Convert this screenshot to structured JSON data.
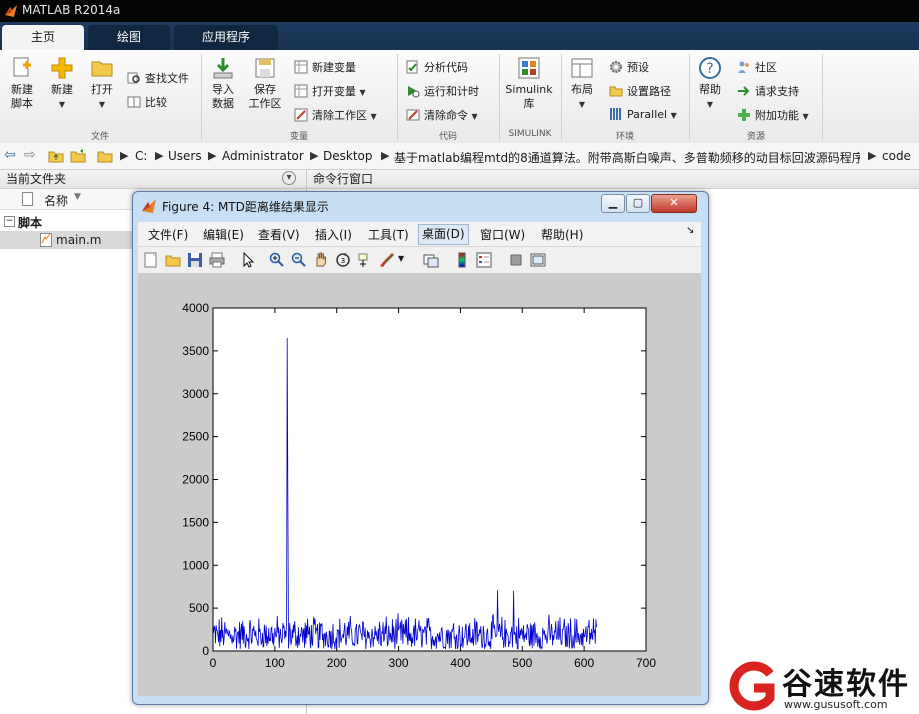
{
  "window": {
    "title": "MATLAB R2014a"
  },
  "tabs": [
    {
      "label": "主页",
      "active": true
    },
    {
      "label": "绘图",
      "active": false
    },
    {
      "label": "应用程序",
      "active": false
    }
  ],
  "ribbon": {
    "file": {
      "new_script": [
        "新建",
        "脚本"
      ],
      "new": "新建",
      "open": "打开",
      "find_files": "查找文件",
      "compare": "比较",
      "group_label": "文件"
    },
    "variable": {
      "import": [
        "导入",
        "数据"
      ],
      "save_ws": [
        "保存",
        "工作区"
      ],
      "new_var": "新建变量",
      "open_var": "打开变量",
      "clear_ws": "清除工作区",
      "group_label": "变量"
    },
    "code": {
      "analyze": "分析代码",
      "run_time": "运行和计时",
      "clear_cmd": "清除命令",
      "group_label": "代码"
    },
    "simulink": {
      "btn": [
        "Simulink",
        "库"
      ],
      "group_label": "SIMULINK"
    },
    "env": {
      "layout": "布局",
      "prefs": "预设",
      "set_path": "设置路径",
      "parallel": "Parallel",
      "group_label": "环境"
    },
    "resources": {
      "help": "帮助",
      "community": "社区",
      "request_support": "请求支持",
      "addons": "附加功能",
      "group_label": "资源"
    }
  },
  "address": {
    "crumbs": [
      "C:",
      "Users",
      "Administrator",
      "Desktop",
      "基于matlab编程mtd的8通道算法。附带高斯白噪声、多普勒频移的动目标回波源码程序",
      "code"
    ]
  },
  "current_folder": {
    "title": "当前文件夹",
    "col_name": "名称",
    "group": "脚本",
    "files": [
      "main.m"
    ]
  },
  "command_window": {
    "title": "命令行窗口"
  },
  "figure": {
    "title": "Figure 4: MTD距离维结果显示",
    "menus": [
      "文件(F)",
      "编辑(E)",
      "查看(V)",
      "插入(I)",
      "工具(T)",
      "桌面(D)",
      "窗口(W)",
      "帮助(H)"
    ],
    "selected_menu": "桌面(D)"
  },
  "chart_data": {
    "type": "line",
    "title": "",
    "xlabel": "",
    "ylabel": "",
    "xlim": [
      0,
      700
    ],
    "ylim": [
      0,
      4000
    ],
    "xticks": [
      0,
      100,
      200,
      300,
      400,
      500,
      600,
      700
    ],
    "yticks": [
      0,
      500,
      1000,
      1500,
      2000,
      2500,
      3000,
      3500,
      4000
    ],
    "grid": false,
    "series": [
      {
        "color": "#0000cc",
        "x_range": [
          1,
          620
        ],
        "noise_floor_typical": [
          100,
          450
        ],
        "peaks": [
          {
            "x": 120,
            "y": 3650
          },
          {
            "x": 121,
            "y": 1950
          },
          {
            "x": 460,
            "y": 710
          },
          {
            "x": 486,
            "y": 700
          }
        ]
      }
    ]
  },
  "watermark": {
    "brand": "谷速软件",
    "url": "www.gususoft.com"
  },
  "colors": {
    "accent": "#183252",
    "plot_line": "#0000cc"
  }
}
